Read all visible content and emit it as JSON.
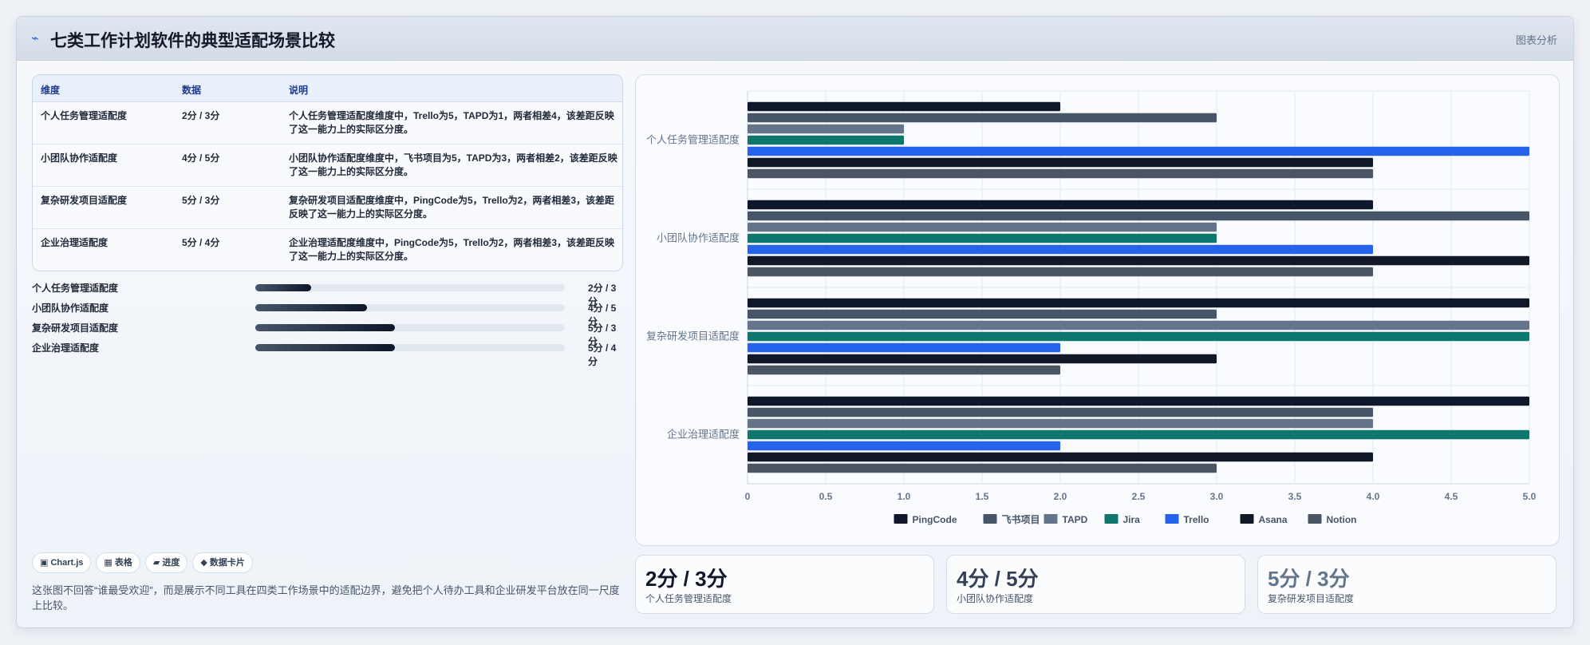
{
  "header": {
    "icon": "pulse-icon",
    "title": "七类工作计划软件的典型适配场景比较",
    "right_label": "图表分析"
  },
  "table": {
    "headers": [
      "维度",
      "数据",
      "说明"
    ],
    "rows": [
      {
        "dimension": "个人任务管理适配度",
        "data": "2分 / 3分",
        "desc": "个人任务管理适配度维度中，Trello为5，TAPD为1，两者相差4，该差距反映了这一能力上的实际区分度。"
      },
      {
        "dimension": "小团队协作适配度",
        "data": "4分 / 5分",
        "desc": "小团队协作适配度维度中，飞书项目为5，TAPD为3，两者相差2，该差距反映了这一能力上的实际区分度。"
      },
      {
        "dimension": "复杂研发项目适配度",
        "data": "5分 / 3分",
        "desc": "复杂研发项目适配度维度中，PingCode为5，Trello为2，两者相差3，该差距反映了这一能力上的实际区分度。"
      },
      {
        "dimension": "企业治理适配度",
        "data": "5分 / 4分",
        "desc": "企业治理适配度维度中，PingCode为5，Trello为2，两者相差3，该差距反映了这一能力上的实际区分度。"
      }
    ]
  },
  "progress": [
    {
      "label": "个人任务管理适配度",
      "value": "2分 / 3分",
      "fraction": 0.18
    },
    {
      "label": "小团队协作适配度",
      "value": "4分 / 5分",
      "fraction": 0.36
    },
    {
      "label": "复杂研发项目适配度",
      "value": "5分 / 3分",
      "fraction": 0.45
    },
    {
      "label": "企业治理适配度",
      "value": "5分 / 4分",
      "fraction": 0.45
    }
  ],
  "chips": [
    "▣ Chart.js",
    "▦ 表格",
    "▰ 进度",
    "◆ 数据卡片"
  ],
  "note": "这张图不回答“谁最受欢迎”，而是展示不同工具在四类工作场景中的适配边界，避免把个人待办工具和企业研发平台放在同一尺度上比较。",
  "kpis": [
    {
      "value": "2分 / 3分",
      "label": "个人任务管理适配度",
      "color": "#0f172a"
    },
    {
      "value": "4分 / 5分",
      "label": "小团队协作适配度",
      "color": "#334155"
    },
    {
      "value": "5分 / 3分",
      "label": "复杂研发项目适配度",
      "color": "#64748b"
    }
  ],
  "chart_data": {
    "type": "bar",
    "orientation": "horizontal",
    "categories": [
      "个人任务管理适配度",
      "小团队协作适配度",
      "复杂研发项目适配度",
      "企业治理适配度"
    ],
    "series": [
      {
        "name": "PingCode",
        "color": "#0f172a",
        "values": [
          2,
          4,
          5,
          5
        ]
      },
      {
        "name": "飞书项目",
        "color": "#475569",
        "values": [
          3,
          5,
          3,
          4
        ]
      },
      {
        "name": "TAPD",
        "color": "#64748b",
        "values": [
          1,
          3,
          5,
          4
        ]
      },
      {
        "name": "Jira",
        "color": "#0f766e",
        "values": [
          1,
          3,
          5,
          5
        ]
      },
      {
        "name": "Trello",
        "color": "#2563eb",
        "values": [
          5,
          4,
          2,
          2
        ]
      },
      {
        "name": "Asana",
        "color": "#111827",
        "values": [
          4,
          5,
          3,
          4
        ]
      },
      {
        "name": "Notion",
        "color": "#4b5563",
        "values": [
          4,
          4,
          2,
          3
        ]
      }
    ],
    "xlim": [
      0,
      5
    ],
    "xticks": [
      "0",
      "0.5",
      "1.0",
      "1.5",
      "2.0",
      "2.5",
      "3.0",
      "3.5",
      "4.0",
      "4.5",
      "5.0"
    ],
    "grid": true,
    "legend": "bottom"
  }
}
